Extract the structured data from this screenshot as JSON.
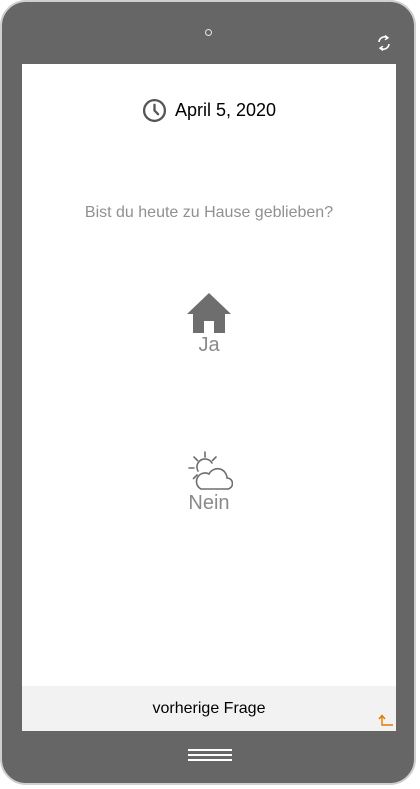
{
  "header": {
    "date": "April 5, 2020",
    "date_icon": "clock-icon"
  },
  "question": "Bist du heute zu Hause geblieben?",
  "choices": [
    {
      "label": "Ja",
      "icon": "house-icon"
    },
    {
      "label": "Nein",
      "icon": "sun-cloud-icon"
    }
  ],
  "footer": {
    "previous_label": "vorherige Frage",
    "corner_icon": "return-arrow-icon"
  },
  "colors": {
    "device_frame": "#666666",
    "icon_gray": "#6e6e6e",
    "label_gray": "#8a8a8a",
    "question_gray": "#909090",
    "footer_bg": "#f2f2f2",
    "accent_orange": "#e07b00"
  }
}
